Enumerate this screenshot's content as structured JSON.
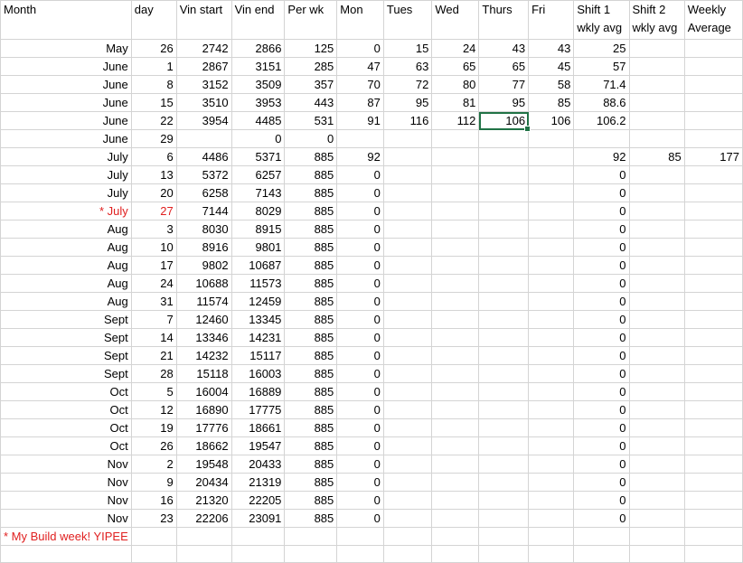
{
  "headers": {
    "month": "Month",
    "day": "day",
    "vin_start": "Vin start",
    "vin_end": "Vin end",
    "per_wk": "Per wk",
    "mon": "Mon",
    "tues": "Tues",
    "wed": "Wed",
    "thurs": "Thurs",
    "fri": "Fri",
    "shift1": [
      "Shift 1",
      "wkly avg"
    ],
    "shift2": [
      "Shift 2",
      "wkly avg"
    ],
    "weekly": [
      "Weekly",
      "Average"
    ]
  },
  "rows": [
    [
      "May",
      "26",
      "2742",
      "2866",
      "125",
      "0",
      "15",
      "24",
      "43",
      "43",
      "25",
      "",
      ""
    ],
    [
      "June",
      "1",
      "2867",
      "3151",
      "285",
      "47",
      "63",
      "65",
      "65",
      "45",
      "57",
      "",
      ""
    ],
    [
      "June",
      "8",
      "3152",
      "3509",
      "357",
      "70",
      "72",
      "80",
      "77",
      "58",
      "71.4",
      "",
      ""
    ],
    [
      "June",
      "15",
      "3510",
      "3953",
      "443",
      "87",
      "95",
      "81",
      "95",
      "85",
      "88.6",
      "",
      ""
    ],
    [
      "June",
      "22",
      "3954",
      "4485",
      "531",
      "91",
      "116",
      "112",
      "106",
      "106",
      "106.2",
      "",
      ""
    ],
    [
      "June",
      "29",
      "",
      "0",
      "0",
      "",
      "",
      "",
      "",
      "",
      "",
      "",
      ""
    ],
    [
      "July",
      "6",
      "4486",
      "5371",
      "885",
      "92",
      "",
      "",
      "",
      "",
      "92",
      "85",
      "177"
    ],
    [
      "July",
      "13",
      "5372",
      "6257",
      "885",
      "0",
      "",
      "",
      "",
      "",
      "0",
      "",
      ""
    ],
    [
      "July",
      "20",
      "6258",
      "7143",
      "885",
      "0",
      "",
      "",
      "",
      "",
      "0",
      "",
      ""
    ],
    [
      "* July",
      "27",
      "7144",
      "8029",
      "885",
      "0",
      "",
      "",
      "",
      "",
      "0",
      "",
      ""
    ],
    [
      "Aug",
      "3",
      "8030",
      "8915",
      "885",
      "0",
      "",
      "",
      "",
      "",
      "0",
      "",
      ""
    ],
    [
      "Aug",
      "10",
      "8916",
      "9801",
      "885",
      "0",
      "",
      "",
      "",
      "",
      "0",
      "",
      ""
    ],
    [
      "Aug",
      "17",
      "9802",
      "10687",
      "885",
      "0",
      "",
      "",
      "",
      "",
      "0",
      "",
      ""
    ],
    [
      "Aug",
      "24",
      "10688",
      "11573",
      "885",
      "0",
      "",
      "",
      "",
      "",
      "0",
      "",
      ""
    ],
    [
      "Aug",
      "31",
      "11574",
      "12459",
      "885",
      "0",
      "",
      "",
      "",
      "",
      "0",
      "",
      ""
    ],
    [
      "Sept",
      "7",
      "12460",
      "13345",
      "885",
      "0",
      "",
      "",
      "",
      "",
      "0",
      "",
      ""
    ],
    [
      "Sept",
      "14",
      "13346",
      "14231",
      "885",
      "0",
      "",
      "",
      "",
      "",
      "0",
      "",
      ""
    ],
    [
      "Sept",
      "21",
      "14232",
      "15117",
      "885",
      "0",
      "",
      "",
      "",
      "",
      "0",
      "",
      ""
    ],
    [
      "Sept",
      "28",
      "15118",
      "16003",
      "885",
      "0",
      "",
      "",
      "",
      "",
      "0",
      "",
      ""
    ],
    [
      "Oct",
      "5",
      "16004",
      "16889",
      "885",
      "0",
      "",
      "",
      "",
      "",
      "0",
      "",
      ""
    ],
    [
      "Oct",
      "12",
      "16890",
      "17775",
      "885",
      "0",
      "",
      "",
      "",
      "",
      "0",
      "",
      ""
    ],
    [
      "Oct",
      "19",
      "17776",
      "18661",
      "885",
      "0",
      "",
      "",
      "",
      "",
      "0",
      "",
      ""
    ],
    [
      "Oct",
      "26",
      "18662",
      "19547",
      "885",
      "0",
      "",
      "",
      "",
      "",
      "0",
      "",
      ""
    ],
    [
      "Nov",
      "2",
      "19548",
      "20433",
      "885",
      "0",
      "",
      "",
      "",
      "",
      "0",
      "",
      ""
    ],
    [
      "Nov",
      "9",
      "20434",
      "21319",
      "885",
      "0",
      "",
      "",
      "",
      "",
      "0",
      "",
      ""
    ],
    [
      "Nov",
      "16",
      "21320",
      "22205",
      "885",
      "0",
      "",
      "",
      "",
      "",
      "0",
      "",
      ""
    ],
    [
      "Nov",
      "23",
      "22206",
      "23091",
      "885",
      "0",
      "",
      "",
      "",
      "",
      "0",
      "",
      ""
    ]
  ],
  "highlight_row": 9,
  "selected_cell": {
    "row": 4,
    "col": 8
  },
  "footnote": "* My Build week! YIPEE",
  "colors": {
    "highlight": "#e02020",
    "selection": "#217346",
    "gridline": "#d4d4d4"
  }
}
